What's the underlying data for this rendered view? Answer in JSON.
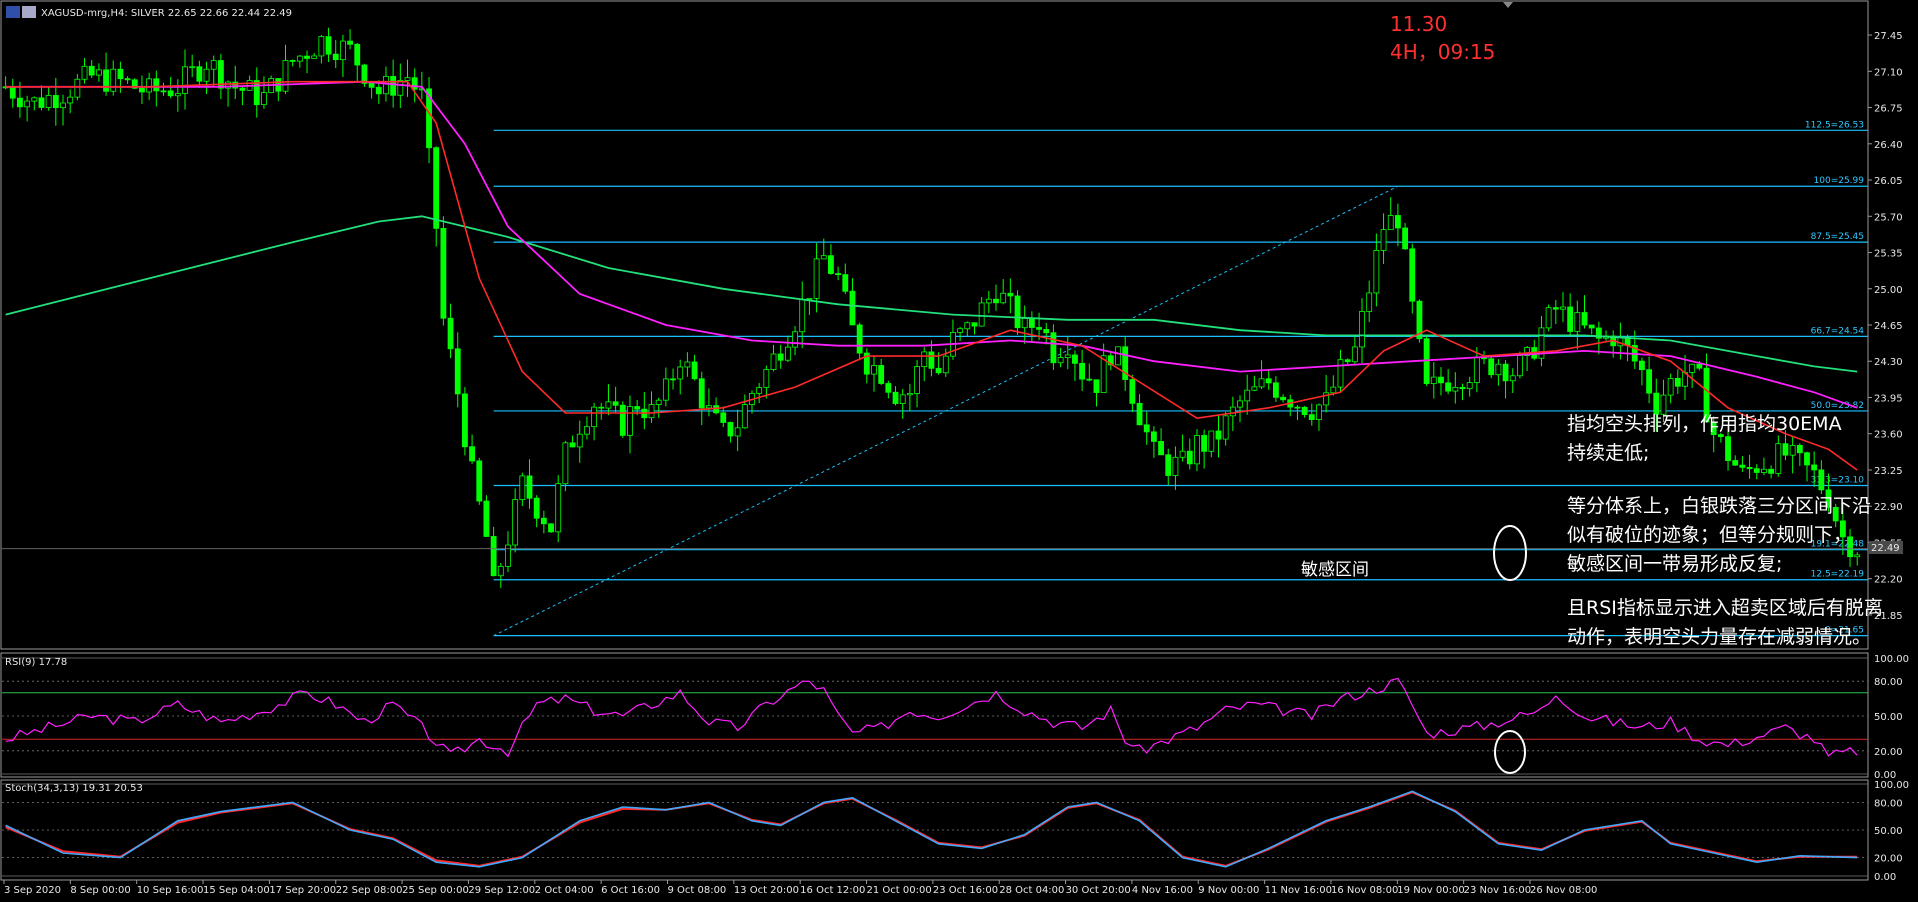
{
  "window": {
    "title": "XAGUSD-mrg,H4:  SILVER  22.65 22.66 22.44 22.49",
    "current_price_tag": "22.49"
  },
  "colors": {
    "background": "#000000",
    "candle": "#00ff00",
    "ema_fast": "#ff2a2a",
    "ema_mid": "#ff20ff",
    "ema_slow": "#22e07a",
    "fib": "#19bfff",
    "rsi": "#ff20ff",
    "stoch_main": "#3fa9ff",
    "stoch_signal": "#ff2a2a",
    "circle": "#ffffff"
  },
  "header_note": {
    "date": "11.30",
    "time": "4H，09:15"
  },
  "annotations": {
    "a1": "指均空头排列，作用指均30EMA\n持续走低;",
    "a2": "等分体系上，白银跌落三分区间下沿\n似有破位的迹象；但等分规则下，\n敏感区间一带易形成反复;",
    "a3": "且RSI指标显示进入超卖区域后有脱离\n动作，表明空头力量存在减弱情况。",
    "sensitive_zone": "敏感区间"
  },
  "rsi_panel": {
    "label": "RSI(9) 17.78"
  },
  "stoch_panel": {
    "label": "Stoch(34,3,13) 19.31 20.53"
  },
  "chart_data": {
    "type": "candlestick",
    "title": "XAGUSD-mrg,H4:  SILVER  22.65 22.66 22.44 22.49",
    "ylim": [
      21.55,
      27.75
    ],
    "y_ticks": [
      "27.45",
      "27.10",
      "26.75",
      "26.40",
      "26.05",
      "25.70",
      "25.35",
      "25.00",
      "24.65",
      "24.30",
      "23.95",
      "23.60",
      "23.25",
      "22.90",
      "22.55",
      "22.20",
      "21.85"
    ],
    "x_ticks": [
      "3 Sep 2020",
      "8 Sep 00:00",
      "10 Sep 16:00",
      "15 Sep 04:00",
      "17 Sep 20:00",
      "22 Sep 08:00",
      "25 Sep 00:00",
      "29 Sep 12:00",
      "2 Oct 04:00",
      "6 Oct 16:00",
      "9 Oct 08:00",
      "13 Oct 20:00",
      "16 Oct 12:00",
      "21 Oct 00:00",
      "23 Oct 16:00",
      "28 Oct 04:00",
      "30 Oct 20:00",
      "4 Nov 16:00",
      "9 Nov 00:00",
      "11 Nov 16:00",
      "16 Nov 08:00",
      "19 Nov 00:00",
      "23 Nov 16:00",
      "26 Nov 08:00"
    ],
    "price_path": [
      [
        0,
        26.95
      ],
      [
        4,
        26.8
      ],
      [
        8,
        26.9
      ],
      [
        12,
        27.05
      ],
      [
        16,
        27.0
      ],
      [
        20,
        26.9
      ],
      [
        24,
        26.95
      ],
      [
        28,
        27.2
      ],
      [
        32,
        26.95
      ],
      [
        36,
        26.85
      ],
      [
        40,
        27.2
      ],
      [
        44,
        27.4
      ],
      [
        48,
        27.3
      ],
      [
        52,
        26.9
      ],
      [
        56,
        27.05
      ],
      [
        58,
        26.85
      ],
      [
        60,
        25.6
      ],
      [
        61,
        24.7
      ],
      [
        63,
        24.0
      ],
      [
        65,
        23.2
      ],
      [
        67,
        22.6
      ],
      [
        68,
        22.1
      ],
      [
        70,
        22.6
      ],
      [
        72,
        23.1
      ],
      [
        74,
        22.9
      ],
      [
        76,
        22.7
      ],
      [
        78,
        23.4
      ],
      [
        80,
        23.7
      ],
      [
        82,
        23.9
      ],
      [
        84,
        23.8
      ],
      [
        86,
        23.7
      ],
      [
        88,
        23.9
      ],
      [
        90,
        23.8
      ],
      [
        92,
        24.0
      ],
      [
        94,
        24.35
      ],
      [
        96,
        24.1
      ],
      [
        98,
        23.8
      ],
      [
        100,
        23.6
      ],
      [
        102,
        23.7
      ],
      [
        104,
        24.0
      ],
      [
        106,
        24.2
      ],
      [
        108,
        24.45
      ],
      [
        110,
        24.7
      ],
      [
        112,
        25.0
      ],
      [
        114,
        25.3
      ],
      [
        116,
        25.1
      ],
      [
        118,
        24.6
      ],
      [
        120,
        24.3
      ],
      [
        122,
        24.2
      ],
      [
        124,
        24.0
      ],
      [
        126,
        24.0
      ],
      [
        128,
        24.4
      ],
      [
        130,
        24.2
      ],
      [
        132,
        24.5
      ],
      [
        134,
        24.6
      ],
      [
        136,
        24.8
      ],
      [
        138,
        25.0
      ],
      [
        140,
        24.8
      ],
      [
        142,
        24.6
      ],
      [
        144,
        24.7
      ],
      [
        146,
        24.4
      ],
      [
        148,
        24.5
      ],
      [
        150,
        24.2
      ],
      [
        152,
        24.1
      ],
      [
        154,
        24.4
      ],
      [
        156,
        24.2
      ],
      [
        158,
        23.8
      ],
      [
        160,
        23.4
      ],
      [
        162,
        23.3
      ],
      [
        164,
        23.3
      ],
      [
        166,
        23.5
      ],
      [
        168,
        23.5
      ],
      [
        170,
        23.7
      ],
      [
        172,
        23.9
      ],
      [
        174,
        24.0
      ],
      [
        176,
        24.1
      ],
      [
        178,
        24.0
      ],
      [
        180,
        23.9
      ],
      [
        182,
        23.85
      ],
      [
        184,
        23.9
      ],
      [
        186,
        24.2
      ],
      [
        188,
        24.4
      ],
      [
        190,
        25.0
      ],
      [
        192,
        25.6
      ],
      [
        194,
        25.7
      ],
      [
        196,
        24.8
      ],
      [
        198,
        24.0
      ],
      [
        200,
        24.1
      ],
      [
        202,
        24.15
      ],
      [
        204,
        24.2
      ],
      [
        206,
        24.25
      ],
      [
        208,
        24.3
      ],
      [
        210,
        24.2
      ],
      [
        212,
        24.3
      ],
      [
        214,
        24.6
      ],
      [
        216,
        24.8
      ],
      [
        218,
        24.7
      ],
      [
        220,
        24.6
      ],
      [
        222,
        24.5
      ],
      [
        224,
        24.55
      ],
      [
        226,
        24.4
      ],
      [
        228,
        24.2
      ],
      [
        230,
        23.9
      ],
      [
        232,
        24.1
      ],
      [
        234,
        24.2
      ],
      [
        236,
        24.1
      ],
      [
        238,
        23.6
      ],
      [
        240,
        23.4
      ],
      [
        242,
        23.2
      ],
      [
        244,
        23.3
      ],
      [
        246,
        23.35
      ],
      [
        248,
        23.4
      ],
      [
        250,
        23.3
      ],
      [
        252,
        23.2
      ],
      [
        254,
        23.0
      ],
      [
        256,
        22.6
      ],
      [
        258,
        22.5
      ]
    ],
    "ema_fast_path": [
      [
        0,
        26.95
      ],
      [
        20,
        26.95
      ],
      [
        40,
        27.0
      ],
      [
        56,
        27.0
      ],
      [
        60,
        26.6
      ],
      [
        66,
        25.1
      ],
      [
        72,
        24.2
      ],
      [
        78,
        23.8
      ],
      [
        90,
        23.8
      ],
      [
        100,
        23.85
      ],
      [
        110,
        24.05
      ],
      [
        120,
        24.35
      ],
      [
        130,
        24.35
      ],
      [
        140,
        24.6
      ],
      [
        150,
        24.45
      ],
      [
        158,
        24.1
      ],
      [
        166,
        23.75
      ],
      [
        176,
        23.85
      ],
      [
        186,
        24.0
      ],
      [
        192,
        24.4
      ],
      [
        198,
        24.6
      ],
      [
        206,
        24.35
      ],
      [
        216,
        24.4
      ],
      [
        224,
        24.5
      ],
      [
        232,
        24.3
      ],
      [
        240,
        23.85
      ],
      [
        248,
        23.6
      ],
      [
        254,
        23.45
      ],
      [
        258,
        23.25
      ]
    ],
    "ema_mid_path": [
      [
        0,
        26.95
      ],
      [
        30,
        26.95
      ],
      [
        50,
        27.0
      ],
      [
        58,
        26.95
      ],
      [
        64,
        26.4
      ],
      [
        70,
        25.6
      ],
      [
        80,
        24.95
      ],
      [
        92,
        24.65
      ],
      [
        104,
        24.5
      ],
      [
        116,
        24.45
      ],
      [
        128,
        24.45
      ],
      [
        140,
        24.5
      ],
      [
        150,
        24.45
      ],
      [
        160,
        24.3
      ],
      [
        172,
        24.2
      ],
      [
        184,
        24.25
      ],
      [
        196,
        24.3
      ],
      [
        208,
        24.35
      ],
      [
        220,
        24.4
      ],
      [
        232,
        24.35
      ],
      [
        244,
        24.15
      ],
      [
        252,
        24.0
      ],
      [
        258,
        23.85
      ]
    ],
    "ema_slow_path": [
      [
        0,
        24.75
      ],
      [
        20,
        25.1
      ],
      [
        40,
        25.45
      ],
      [
        52,
        25.65
      ],
      [
        58,
        25.7
      ],
      [
        70,
        25.5
      ],
      [
        84,
        25.2
      ],
      [
        100,
        25.0
      ],
      [
        116,
        24.85
      ],
      [
        132,
        24.75
      ],
      [
        148,
        24.7
      ],
      [
        160,
        24.7
      ],
      [
        172,
        24.6
      ],
      [
        184,
        24.55
      ],
      [
        196,
        24.55
      ],
      [
        208,
        24.55
      ],
      [
        220,
        24.55
      ],
      [
        232,
        24.5
      ],
      [
        244,
        24.35
      ],
      [
        252,
        24.25
      ],
      [
        258,
        24.2
      ]
    ],
    "fib_levels": [
      {
        "label": "112.5=26.53",
        "value": 26.53
      },
      {
        "label": "100=25.99",
        "value": 25.99
      },
      {
        "label": "87.5=25.45",
        "value": 25.45
      },
      {
        "label": "66.7=24.54",
        "value": 24.54
      },
      {
        "label": "50.0=23.82",
        "value": 23.82
      },
      {
        "label": "33.3=23.10",
        "value": 23.1
      },
      {
        "label": "19.1=22.48",
        "value": 22.48
      },
      {
        "label": "12.5=22.19",
        "value": 22.19
      },
      {
        "label": "0=21.65",
        "value": 21.65
      }
    ],
    "fib_trend": {
      "from": [
        68,
        21.65
      ],
      "to": [
        194,
        25.99
      ]
    },
    "rsi": {
      "name": "RSI(9)",
      "last": 17.78,
      "ylim": [
        0,
        100
      ],
      "y_ticks": [
        "100.00",
        "80.00",
        "50.00",
        "20.00",
        "0.00"
      ],
      "levels": [
        30,
        70
      ],
      "path": [
        [
          0,
          30
        ],
        [
          6,
          40
        ],
        [
          12,
          50
        ],
        [
          18,
          45
        ],
        [
          24,
          60
        ],
        [
          30,
          45
        ],
        [
          36,
          55
        ],
        [
          42,
          70
        ],
        [
          46,
          60
        ],
        [
          50,
          45
        ],
        [
          54,
          60
        ],
        [
          58,
          40
        ],
        [
          62,
          15
        ],
        [
          66,
          30
        ],
        [
          70,
          20
        ],
        [
          74,
          60
        ],
        [
          78,
          65
        ],
        [
          82,
          55
        ],
        [
          86,
          50
        ],
        [
          90,
          60
        ],
        [
          94,
          70
        ],
        [
          98,
          45
        ],
        [
          102,
          40
        ],
        [
          106,
          60
        ],
        [
          110,
          75
        ],
        [
          112,
          80
        ],
        [
          114,
          72
        ],
        [
          116,
          50
        ],
        [
          118,
          35
        ],
        [
          122,
          40
        ],
        [
          126,
          55
        ],
        [
          130,
          50
        ],
        [
          134,
          60
        ],
        [
          138,
          70
        ],
        [
          142,
          55
        ],
        [
          146,
          45
        ],
        [
          150,
          40
        ],
        [
          154,
          55
        ],
        [
          156,
          30
        ],
        [
          158,
          20
        ],
        [
          162,
          30
        ],
        [
          166,
          40
        ],
        [
          170,
          55
        ],
        [
          174,
          60
        ],
        [
          178,
          55
        ],
        [
          182,
          50
        ],
        [
          186,
          65
        ],
        [
          190,
          72
        ],
        [
          194,
          80
        ],
        [
          196,
          60
        ],
        [
          198,
          35
        ],
        [
          202,
          38
        ],
        [
          206,
          42
        ],
        [
          210,
          48
        ],
        [
          214,
          55
        ],
        [
          216,
          70
        ],
        [
          220,
          50
        ],
        [
          224,
          45
        ],
        [
          228,
          40
        ],
        [
          232,
          45
        ],
        [
          236,
          30
        ],
        [
          240,
          25
        ],
        [
          244,
          32
        ],
        [
          248,
          40
        ],
        [
          252,
          30
        ],
        [
          254,
          15
        ],
        [
          256,
          18
        ],
        [
          258,
          20
        ]
      ]
    },
    "stoch": {
      "name": "Stoch(34,3,13)",
      "main": 19.31,
      "signal": 20.53,
      "ylim": [
        0,
        100
      ],
      "y_ticks": [
        "100.00",
        "80.00",
        "50.00",
        "20.00",
        "0.00"
      ],
      "levels": [
        20,
        80
      ],
      "main_path": [
        [
          0,
          55
        ],
        [
          8,
          25
        ],
        [
          16,
          20
        ],
        [
          24,
          60
        ],
        [
          30,
          70
        ],
        [
          40,
          80
        ],
        [
          48,
          50
        ],
        [
          54,
          40
        ],
        [
          60,
          15
        ],
        [
          66,
          10
        ],
        [
          72,
          20
        ],
        [
          80,
          60
        ],
        [
          86,
          75
        ],
        [
          92,
          72
        ],
        [
          98,
          80
        ],
        [
          104,
          60
        ],
        [
          108,
          55
        ],
        [
          114,
          80
        ],
        [
          118,
          85
        ],
        [
          124,
          60
        ],
        [
          130,
          35
        ],
        [
          136,
          30
        ],
        [
          142,
          45
        ],
        [
          148,
          75
        ],
        [
          152,
          80
        ],
        [
          158,
          60
        ],
        [
          164,
          20
        ],
        [
          170,
          10
        ],
        [
          176,
          30
        ],
        [
          184,
          60
        ],
        [
          190,
          75
        ],
        [
          196,
          92
        ],
        [
          202,
          70
        ],
        [
          208,
          35
        ],
        [
          214,
          28
        ],
        [
          220,
          50
        ],
        [
          228,
          60
        ],
        [
          232,
          35
        ],
        [
          238,
          25
        ],
        [
          244,
          15
        ],
        [
          250,
          22
        ],
        [
          258,
          20
        ]
      ],
      "signal_path": [
        [
          0,
          53
        ],
        [
          8,
          27
        ],
        [
          16,
          21
        ],
        [
          24,
          58
        ],
        [
          30,
          69
        ],
        [
          40,
          79
        ],
        [
          48,
          51
        ],
        [
          54,
          41
        ],
        [
          60,
          17
        ],
        [
          66,
          11
        ],
        [
          72,
          21
        ],
        [
          80,
          58
        ],
        [
          86,
          73
        ],
        [
          92,
          72
        ],
        [
          98,
          79
        ],
        [
          104,
          61
        ],
        [
          108,
          56
        ],
        [
          114,
          79
        ],
        [
          118,
          84
        ],
        [
          124,
          61
        ],
        [
          130,
          36
        ],
        [
          136,
          31
        ],
        [
          142,
          44
        ],
        [
          148,
          74
        ],
        [
          152,
          79
        ],
        [
          158,
          61
        ],
        [
          164,
          21
        ],
        [
          170,
          11
        ],
        [
          176,
          29
        ],
        [
          184,
          59
        ],
        [
          190,
          74
        ],
        [
          196,
          91
        ],
        [
          202,
          71
        ],
        [
          208,
          36
        ],
        [
          214,
          29
        ],
        [
          220,
          49
        ],
        [
          228,
          59
        ],
        [
          232,
          36
        ],
        [
          238,
          26
        ],
        [
          244,
          16
        ],
        [
          250,
          21
        ],
        [
          258,
          21
        ]
      ]
    }
  }
}
